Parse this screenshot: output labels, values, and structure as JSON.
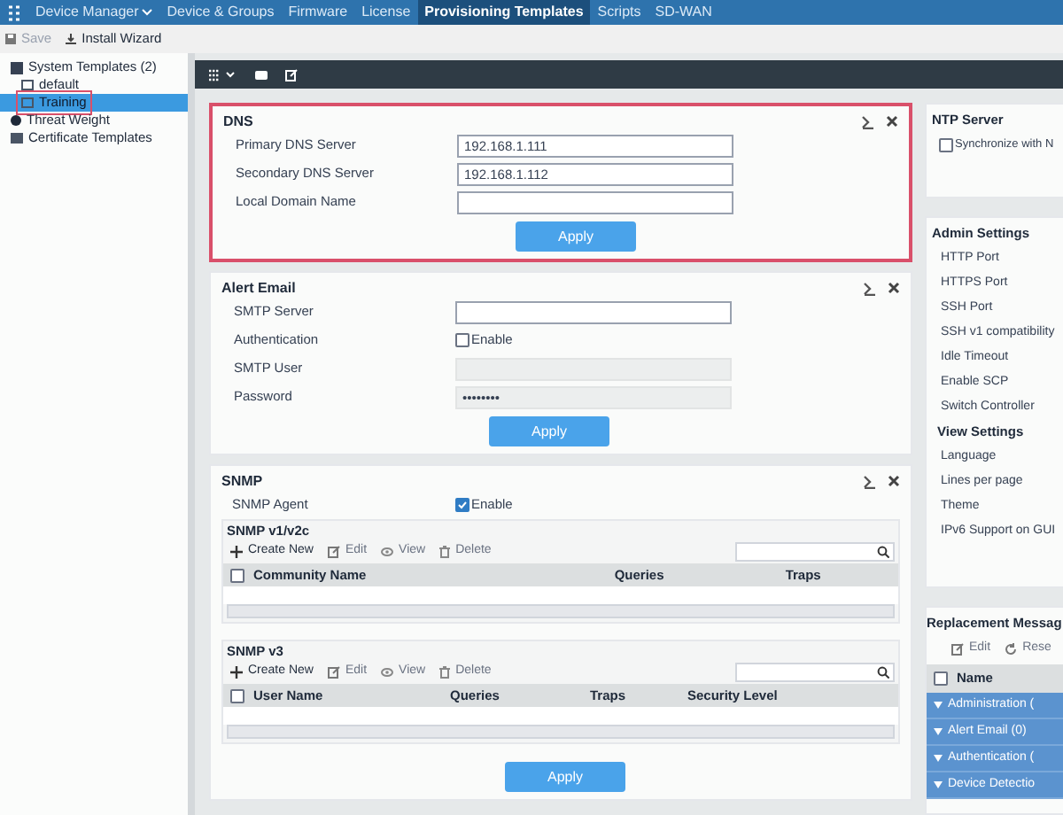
{
  "nav": {
    "items": [
      {
        "label": "Device Manager",
        "caret": true,
        "selected": false
      },
      {
        "label": "Device & Groups",
        "caret": false,
        "selected": false
      },
      {
        "label": "Firmware",
        "caret": false,
        "selected": false
      },
      {
        "label": "License",
        "caret": false,
        "selected": false
      },
      {
        "label": "Provisioning Templates",
        "caret": false,
        "selected": true
      },
      {
        "label": "Scripts",
        "caret": false,
        "selected": false
      },
      {
        "label": "SD-WAN",
        "caret": false,
        "selected": false
      }
    ]
  },
  "toolbar": {
    "buttons": [
      {
        "label": "Save",
        "kind": "save",
        "disabled": true
      },
      {
        "label": "Install Wizard",
        "kind": "install",
        "disabled": false
      }
    ]
  },
  "sidebar": {
    "items": [
      {
        "label": "System Templates (2)",
        "kind": "folder",
        "selected": false,
        "highlighted": false,
        "children": [
          {
            "label": "default",
            "kind": "template",
            "selected": false,
            "highlighted": false
          },
          {
            "label": "Training",
            "kind": "template",
            "selected": true,
            "highlighted": true
          }
        ]
      },
      {
        "label": "Threat Weight",
        "kind": "weight",
        "selected": false,
        "highlighted": false
      },
      {
        "label": "Certificate Templates",
        "kind": "certificate",
        "selected": false,
        "highlighted": false
      }
    ]
  },
  "dns": {
    "title": "DNS",
    "highlighted": true,
    "fields": [
      {
        "label": "Primary DNS Server",
        "kind": "text",
        "value": "192.168.1.111"
      },
      {
        "label": "Secondary DNS Server",
        "kind": "text",
        "value": "192.168.1.112"
      },
      {
        "label": "Local Domain Name",
        "kind": "text"
      }
    ],
    "button": "Apply"
  },
  "alert_email": {
    "title": "Alert Email",
    "highlighted": false,
    "fields": [
      {
        "label": "SMTP Server",
        "kind": "text",
        "disabled": false
      },
      {
        "label": "Authentication",
        "kind": "checkbox",
        "check_label": "Enable",
        "checked": false
      },
      {
        "label": "SMTP User",
        "kind": "text",
        "disabled": true
      },
      {
        "label": "Password",
        "kind": "text",
        "value": "••••••••",
        "disabled": true
      }
    ],
    "button": "Apply"
  },
  "snmp": {
    "title": "SNMP",
    "agent": {
      "label": "SNMP Agent",
      "check_label": "Enable",
      "checked": true
    },
    "tables": [
      {
        "title": "SNMP v1/v2c",
        "select_all_checked": false,
        "actions": [
          "Create New",
          "Edit",
          "View",
          "Delete"
        ],
        "columns": [
          "Community Name",
          "Queries",
          "Traps"
        ]
      },
      {
        "title": "SNMP v3",
        "select_all_checked": false,
        "actions": [
          "Create New",
          "Edit",
          "View",
          "Delete"
        ],
        "columns": [
          "User Name",
          "Queries",
          "Traps",
          "Security Level"
        ]
      }
    ],
    "button": "Apply"
  },
  "ntp": {
    "title": "NTP Server",
    "checkbox": {
      "label": "Synchronize with N",
      "checked": false
    }
  },
  "admin_settings": {
    "title": "Admin Settings",
    "items": [
      {
        "label": "HTTP Port",
        "kind": "item"
      },
      {
        "label": "HTTPS Port",
        "kind": "item"
      },
      {
        "label": "SSH Port",
        "kind": "item"
      },
      {
        "label": "SSH v1 compatibility",
        "kind": "item"
      },
      {
        "label": "Idle Timeout",
        "kind": "item"
      },
      {
        "label": "Enable SCP",
        "kind": "item"
      },
      {
        "label": "Switch Controller",
        "kind": "item"
      },
      {
        "label": "View Settings",
        "kind": "heading"
      },
      {
        "label": "Language",
        "kind": "item"
      },
      {
        "label": "Lines per page",
        "kind": "item"
      },
      {
        "label": "Theme",
        "kind": "item"
      },
      {
        "label": "IPv6 Support on GUI",
        "kind": "item"
      }
    ]
  },
  "replacement": {
    "title": "Replacement Messag",
    "actions": [
      "Edit",
      "Rese"
    ],
    "select_all_checked": false,
    "columns": [
      "Name"
    ],
    "rows": [
      "Administration (",
      "Alert Email (0)",
      "Authentication (",
      "Device Detectio"
    ]
  }
}
